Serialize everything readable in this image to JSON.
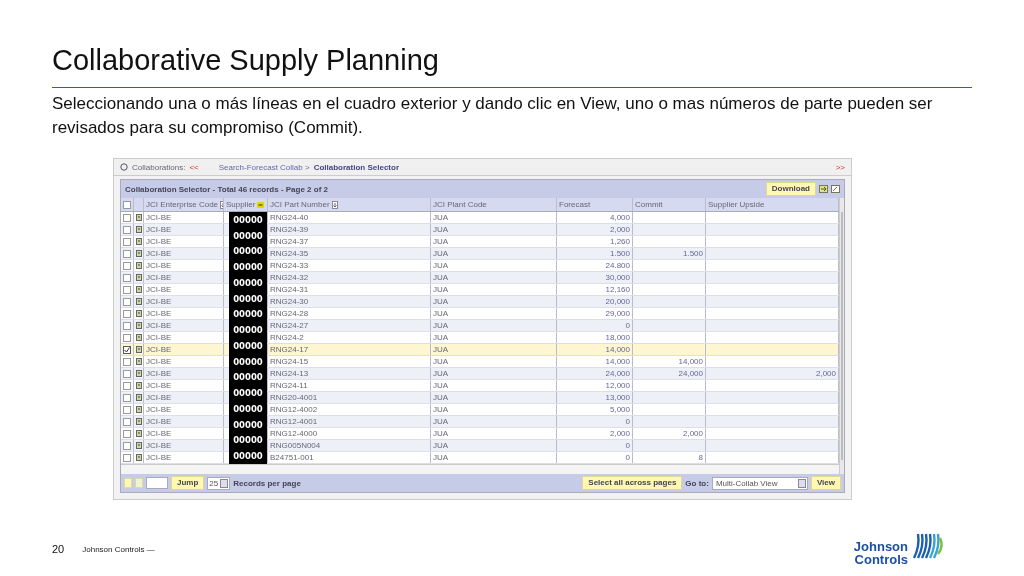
{
  "slide": {
    "title": "Collaborative Supply Planning",
    "text": "Seleccionando una o más líneas en el cuadro exterior y dando clic en View, uno o mas números de parte pueden ser revisados para su compromiso (Commit).",
    "page_number": "20",
    "footer": "Johnson Controls —",
    "logo": [
      "Johnson",
      "Controls"
    ]
  },
  "app": {
    "top_bar": {
      "label": "Collaborations:",
      "back": "<<",
      "breadcrumb": "Search-Forecast Collab >",
      "current": "Collaboration Selector",
      "forward": ">>"
    },
    "select_all_checked": false,
    "panel_title": "Collaboration Selector - Total 46 records - Page 2 of 2",
    "download": "Download",
    "columns": [
      "JCI Enterprise Code",
      "Supplier",
      "JCI Part Number",
      "JCI Plant Code",
      "Forecast",
      "Commit",
      "Supplier Upside"
    ],
    "supplier_labels": [
      "00000",
      "00000",
      "00000",
      "00000",
      "00000",
      "00000",
      "00000",
      "00000",
      "00000",
      "00000",
      "00000",
      "00000",
      "00000",
      "00000",
      "00000",
      "00000"
    ],
    "rows": [
      {
        "checked": false,
        "enterprise": "JCI-BE",
        "part": "RNG24-40",
        "plant": "JUA",
        "forecast": "4,000"
      },
      {
        "checked": false,
        "enterprise": "JCI-BE",
        "part": "RNG24-39",
        "plant": "JUA",
        "forecast": "2,000"
      },
      {
        "checked": false,
        "enterprise": "JCI-BE",
        "part": "RNG24-37",
        "plant": "JUA",
        "forecast": "1,260"
      },
      {
        "checked": false,
        "enterprise": "JCI-BE",
        "part": "RNG24-35",
        "plant": "JUA",
        "forecast": "1.500",
        "commit": "1.500"
      },
      {
        "checked": false,
        "enterprise": "JCI-BE",
        "part": "RNG24-33",
        "plant": "JUA",
        "forecast": "24.800"
      },
      {
        "checked": false,
        "enterprise": "JCI-BE",
        "part": "RNG24-32",
        "plant": "JUA",
        "forecast": "30,000"
      },
      {
        "checked": false,
        "enterprise": "JCI-BE",
        "part": "RNG24-31",
        "plant": "JUA",
        "forecast": "12,160"
      },
      {
        "checked": false,
        "enterprise": "JCI-BE",
        "part": "RNG24-30",
        "plant": "JUA",
        "forecast": "20,000"
      },
      {
        "checked": false,
        "enterprise": "JCI-BE",
        "part": "RNG24-28",
        "plant": "JUA",
        "forecast": "29,000"
      },
      {
        "checked": false,
        "enterprise": "JCI-BE",
        "part": "RNG24-27",
        "plant": "JUA",
        "forecast": "0"
      },
      {
        "checked": false,
        "enterprise": "JCI-BE",
        "part": "RNG24-2",
        "plant": "JUA",
        "forecast": "18,000"
      },
      {
        "checked": true,
        "enterprise": "JCI-BE",
        "part": "RNG24-17",
        "plant": "JUA",
        "forecast": "14,000"
      },
      {
        "checked": false,
        "enterprise": "JCI-BE",
        "part": "RNG24-15",
        "plant": "JUA",
        "forecast": "14,000",
        "commit": "14,000"
      },
      {
        "checked": false,
        "enterprise": "JCI-BE",
        "part": "RNG24-13",
        "plant": "JUA",
        "forecast": "24,000",
        "commit": "24,000",
        "upside": "2,000"
      },
      {
        "checked": false,
        "enterprise": "JCI-BE",
        "part": "RNG24-11",
        "plant": "JUA",
        "forecast": "12,000"
      },
      {
        "checked": false,
        "enterprise": "JCI-BE",
        "part": "RNG20-4001",
        "plant": "JUA",
        "forecast": "13,000"
      },
      {
        "checked": false,
        "enterprise": "JCI-BE",
        "part": "RNG12-4002",
        "plant": "JUA",
        "forecast": "5,000"
      },
      {
        "checked": false,
        "enterprise": "JCI-BE",
        "part": "RNG12-4001",
        "plant": "JUA",
        "forecast": "0"
      },
      {
        "checked": false,
        "enterprise": "JCI-BE",
        "part": "RNG12-4000",
        "plant": "JUA",
        "forecast": "2,000",
        "commit": "2,000"
      },
      {
        "checked": false,
        "enterprise": "JCI-BE",
        "part": "RNG005N004",
        "plant": "JUA",
        "forecast": "0"
      },
      {
        "checked": false,
        "enterprise": "JCI-BE",
        "part": "B24751-001",
        "plant": "JUA",
        "forecast": "0",
        "commit": "8"
      }
    ],
    "footer": {
      "jump": "Jump",
      "per_page": "25",
      "per_page_label": "Records per page",
      "select_all": "Select all across pages",
      "goto": "Go to:",
      "view_select": "Multi-Collab View",
      "view": "View"
    }
  }
}
